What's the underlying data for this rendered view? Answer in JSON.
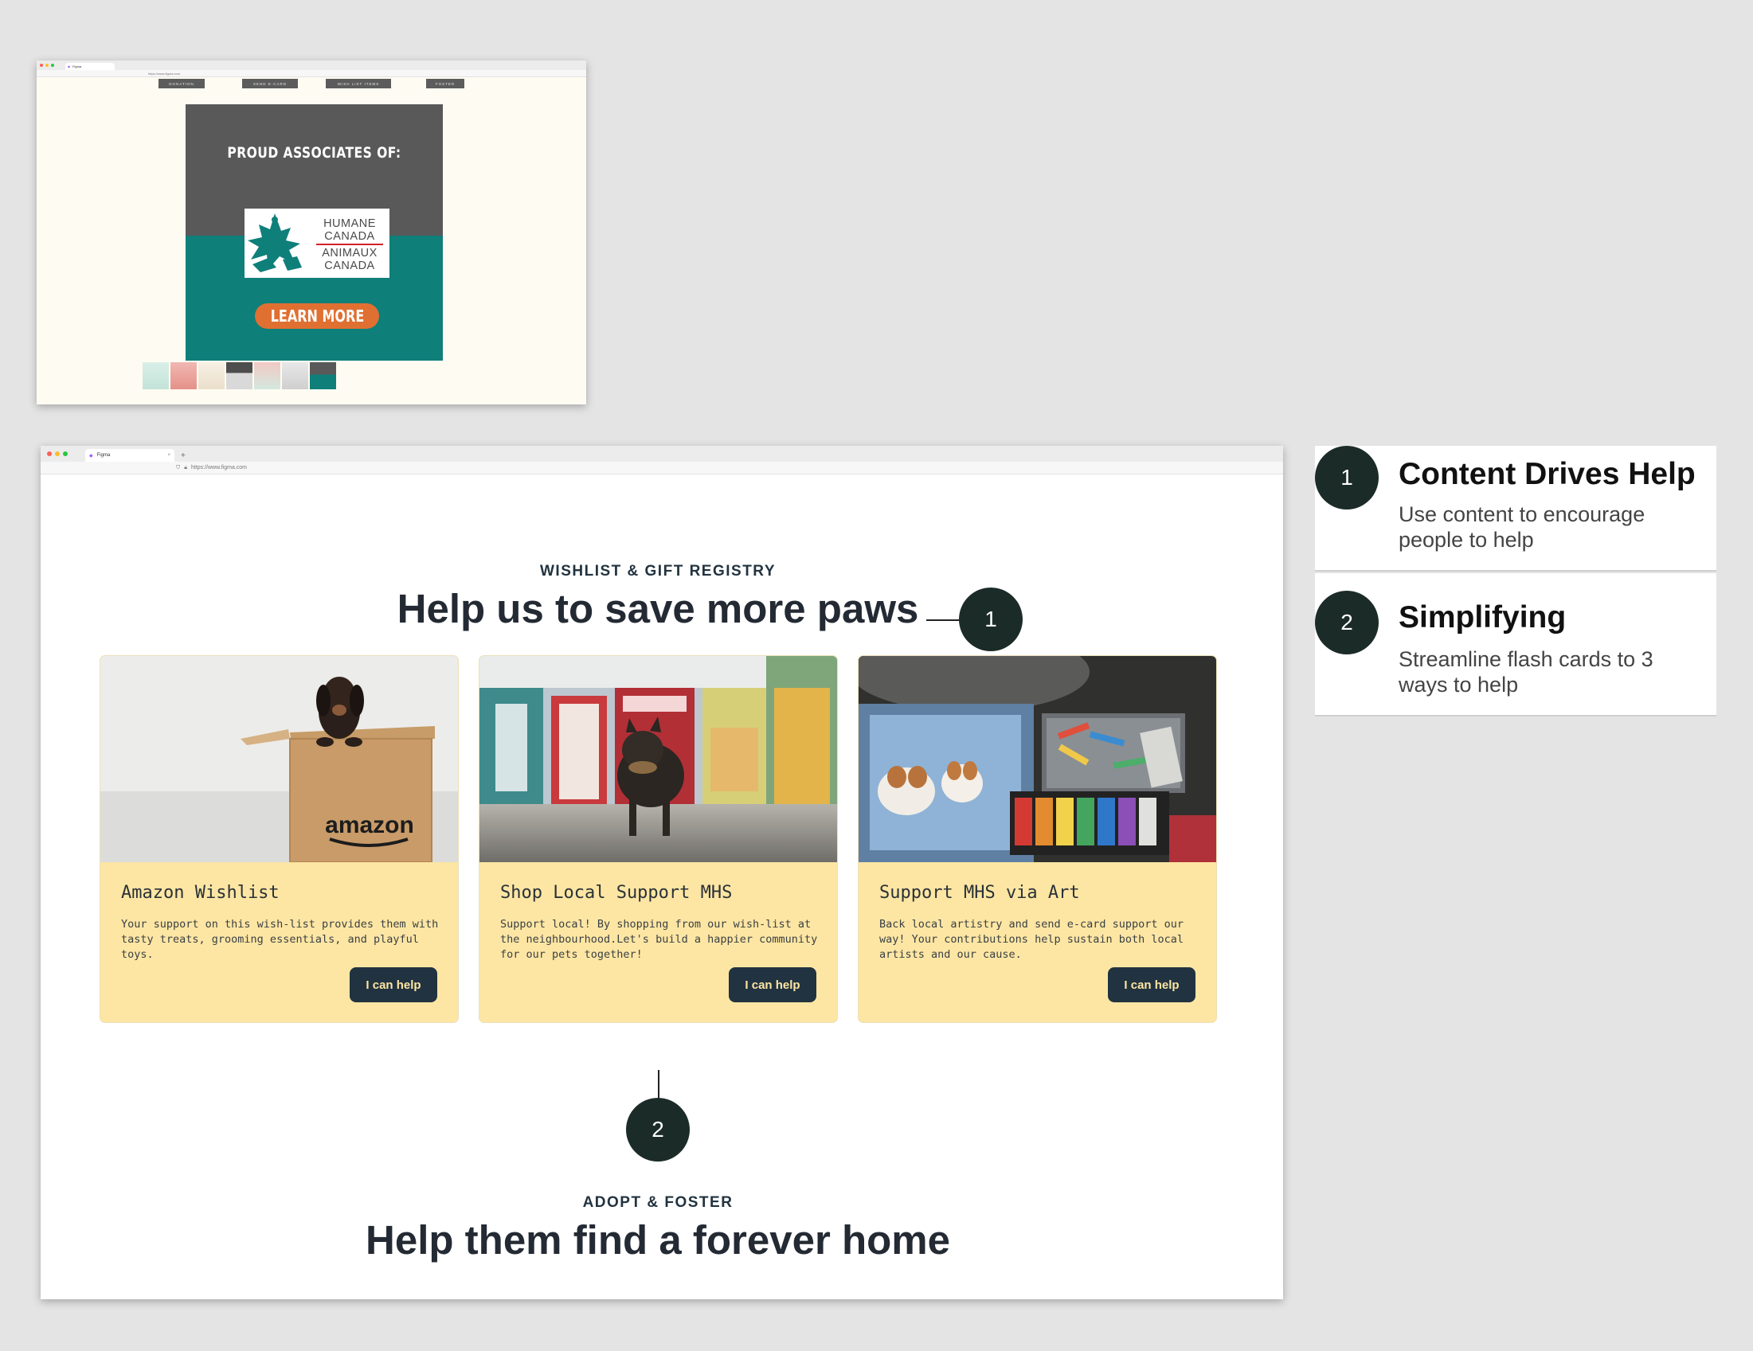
{
  "preview": {
    "tab_title": "Figma",
    "url": "https://www.figma.com",
    "nav": [
      "DONATION",
      "SEND E-CARD",
      "WISH LIST ITEMS",
      "FOSTER"
    ],
    "banner_title": "PROUD ASSOCIATES OF:",
    "logo_lines": [
      "HUMANE",
      "CANADA",
      "ANIMAUX",
      "CANADA"
    ],
    "learn_more": "LEARN MORE",
    "colors": {
      "banner_gray": "#595959",
      "banner_teal": "#0f7f7a",
      "learn_orange": "#e07032",
      "page_bg": "#fefcf2"
    }
  },
  "main": {
    "tab_title": "Figma",
    "url": "https://www.figma.com",
    "wishlist_kicker": "WISHLIST & GIFT REGISTRY",
    "wishlist_title": "Help us to save more paws",
    "cards": [
      {
        "title": "Amazon Wishlist",
        "desc": "Your support on this wish-list provides them with tasty treats, grooming essentials, and playful toys.",
        "button": "I can help",
        "image": "dachshund-in-amazon-box"
      },
      {
        "title": "Shop Local Support MHS",
        "desc": "Support local! By shopping from our wish-list at the neighbourhood.Let's build a happier community for our pets together!",
        "button": "I can help",
        "image": "french-bulldog-in-pet-store"
      },
      {
        "title": "Support MHS via Art",
        "desc": "Back local artistry and send e-card support our way! Your contributions help sustain both local artists and our cause.",
        "button": "I can help",
        "image": "puppy-painting-and-pastels"
      }
    ],
    "amazon_logo_text": "amazon",
    "adopt_kicker": "ADOPT & FOSTER",
    "adopt_title": "Help them find a forever home",
    "colors": {
      "card_bg": "#fde6a3",
      "button_bg": "#213341",
      "heading": "#242a33"
    }
  },
  "callouts": [
    {
      "number": "1",
      "title": "Content Drives Help",
      "desc": "Use content to encourage people to help"
    },
    {
      "number": "2",
      "title": "Simplifying",
      "desc": "Streamline flash cards to 3 ways to help"
    }
  ],
  "marker_color": "#1b2b28"
}
